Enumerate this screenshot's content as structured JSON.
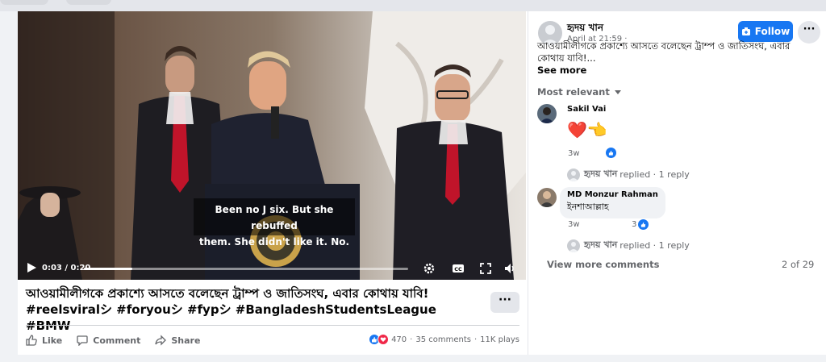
{
  "video": {
    "caption_line1": "Been no J six. But she rebuffed",
    "caption_line2": "them. She didn't like it. No.",
    "current_time": "0:03",
    "duration": "0:20",
    "time_label": "0:03 / 0:20",
    "progress": 0.15
  },
  "post": {
    "title": "আওয়ামীলীগকে প্রকাশ্যে আসতে বলেছেন ট্রাম্প ও জাতিসংঘ, এবার কোথায় যাবি! #reelsviralシ #foryouシ #fypシ #BangladeshStudentsLeague #BMW",
    "more_label": "···",
    "actions": {
      "like": "Like",
      "comment": "Comment",
      "share": "Share"
    },
    "stats": {
      "reactions": "470",
      "comments": "35 comments",
      "plays": "11K plays"
    }
  },
  "panel": {
    "author": "হৃদয় খান",
    "date": "April at 21:59 ·",
    "follow_label": "Follow",
    "dots_label": "···",
    "description": "আওয়ামীলীগকে প্রকাশ্যে আসতে বলেছেন ট্রাম্প ও জাতিসংঘ, এবার কোথায় যাবি!...",
    "see_more": "See more",
    "sort_label": "Most relevant"
  },
  "comments": [
    {
      "name": "Sakil Vai",
      "text": "❤️👈",
      "time": "3w",
      "like_count": "",
      "reply_author": "হৃদয় খান",
      "reply_text": "replied · 1 reply"
    },
    {
      "name": "MD Monzur Rahman",
      "text": "ইনশাআল্লাহ",
      "time": "3w",
      "like_count": "3",
      "reply_author": "হৃদয় খান",
      "reply_text": "replied · 1 reply"
    }
  ],
  "footer": {
    "view_more": "View more comments",
    "count": "2 of 29"
  },
  "colors": {
    "accent": "#1877f2",
    "heart": "#f02849"
  }
}
